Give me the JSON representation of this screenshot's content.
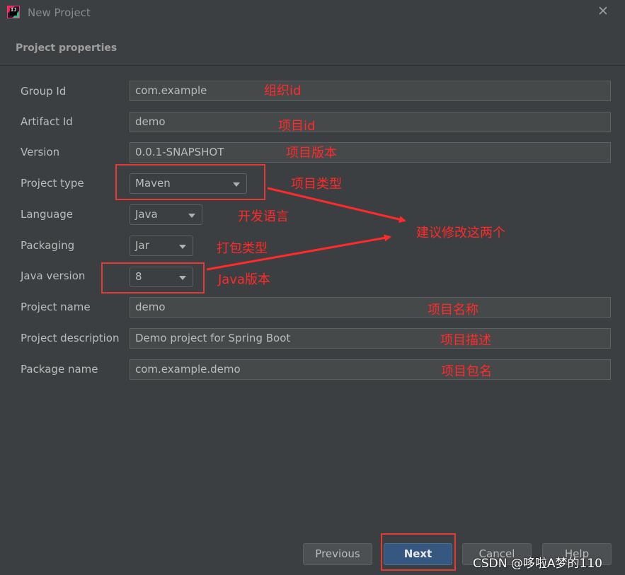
{
  "window": {
    "title": "New Project"
  },
  "section": {
    "title": "Project properties"
  },
  "fields": {
    "group_id": {
      "label": "Group Id",
      "value": "com.example"
    },
    "artifact_id": {
      "label": "Artifact Id",
      "value": "demo"
    },
    "version": {
      "label": "Version",
      "value": "0.0.1-SNAPSHOT"
    },
    "project_type": {
      "label": "Project type",
      "value": "Maven"
    },
    "language": {
      "label": "Language",
      "value": "Java"
    },
    "packaging": {
      "label": "Packaging",
      "value": "Jar"
    },
    "java_version": {
      "label": "Java version",
      "value": "8"
    },
    "project_name": {
      "label": "Project name",
      "value": "demo"
    },
    "project_description": {
      "label": "Project description",
      "value": "Demo project for Spring Boot"
    },
    "package_name": {
      "label": "Package name",
      "value": "com.example.demo"
    }
  },
  "annotations": {
    "group_id": "组织id",
    "artifact_id": "项目id",
    "version": "项目版本",
    "project_type": "项目类型",
    "language": "开发语言",
    "packaging": "打包类型",
    "java_version": "Java版本",
    "suggestion": "建议修改这两个",
    "project_name": "项目名称",
    "project_description": "项目描述",
    "package_name": "项目包名"
  },
  "buttons": {
    "previous": "Previous",
    "next": "Next",
    "cancel": "Cancel",
    "help": "Help"
  },
  "watermark": "CSDN @哆啦A梦的110",
  "colors": {
    "background": "#3c3f41",
    "field_bg": "#45494a",
    "annotation": "#ff2a2a",
    "primary_button": "#365880"
  },
  "icons": {
    "app": "intellij-idea-icon",
    "close": "close-icon",
    "dropdown": "chevron-down-icon"
  }
}
